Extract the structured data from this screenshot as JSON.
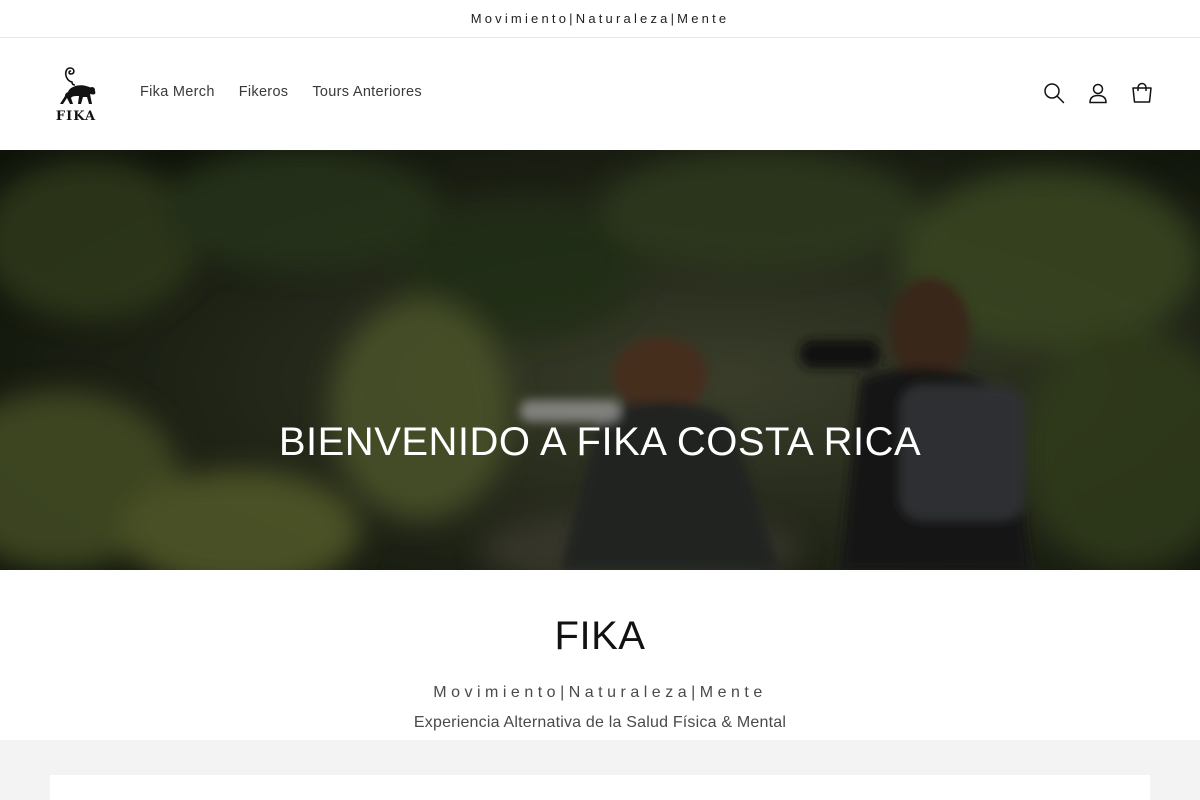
{
  "announcement": {
    "text": "Movimiento|Naturaleza|Mente"
  },
  "header": {
    "logo_text": "FIKA",
    "nav": [
      {
        "label": "Fika Merch"
      },
      {
        "label": "Fikeros"
      },
      {
        "label": "Tours Anteriores"
      }
    ],
    "icons": [
      "search-icon",
      "account-icon",
      "cart-icon"
    ]
  },
  "hero": {
    "title": "BIENVENIDO A FIKA COSTA RICA"
  },
  "intro": {
    "title": "FIKA",
    "tagline": "Movimiento|Naturaleza|Mente",
    "subtitle": "Experiencia Alternativa de la Salud Física & Mental"
  },
  "colors": {
    "text": "#121212",
    "muted": "#4a4a4a",
    "hero_overlay": "#1e2415",
    "section_bg": "#f3f3f3"
  }
}
